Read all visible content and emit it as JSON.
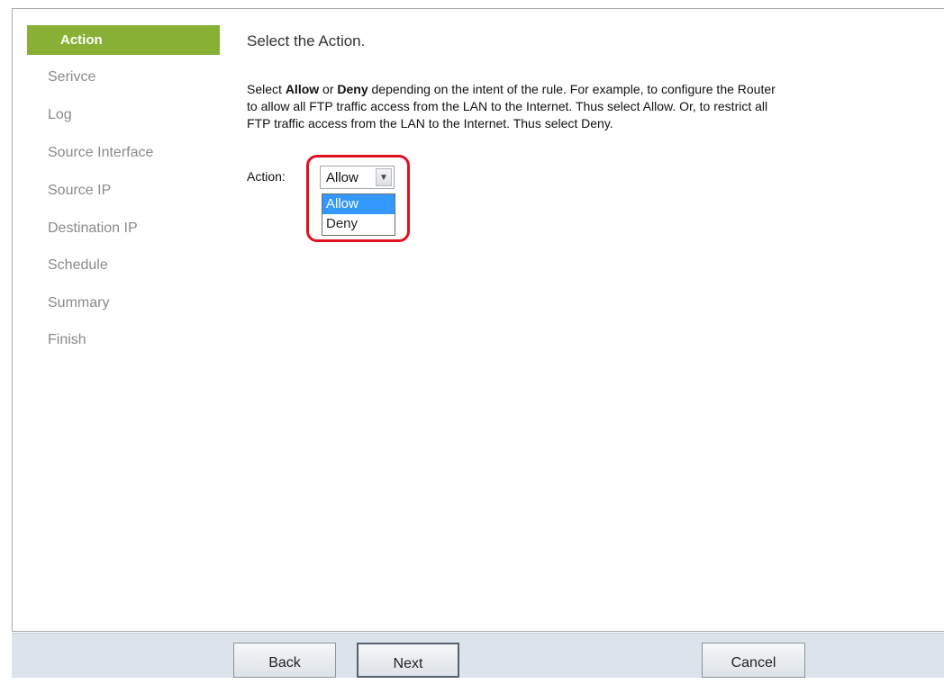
{
  "sidebar": {
    "items": [
      {
        "label": "Action",
        "active": true
      },
      {
        "label": "Serivce"
      },
      {
        "label": "Log"
      },
      {
        "label": "Source Interface"
      },
      {
        "label": "Source IP"
      },
      {
        "label": "Destination IP"
      },
      {
        "label": "Schedule"
      },
      {
        "label": "Summary"
      },
      {
        "label": "Finish"
      }
    ]
  },
  "main": {
    "title": "Select the Action.",
    "description": {
      "t1": "Select ",
      "b1": "Allow",
      "t2": " or ",
      "b2": "Deny",
      "t3": " depending on the intent of the rule. For example, to configure the Router",
      "line2": "to allow all FTP traffic access from the LAN to the Internet. Thus select Allow. Or, to restrict all",
      "line3": "FTP traffic access from the LAN to the Internet. Thus select Deny."
    },
    "action_label": "Action:",
    "action_select": {
      "value": "Allow",
      "options": [
        "Allow",
        "Deny"
      ]
    }
  },
  "footer": {
    "back_label": "Back",
    "next_label": "Next",
    "cancel_label": "Cancel"
  },
  "colors": {
    "active_nav": "#88b034",
    "highlight": "#e0101e",
    "selected_option": "#3399ff"
  }
}
